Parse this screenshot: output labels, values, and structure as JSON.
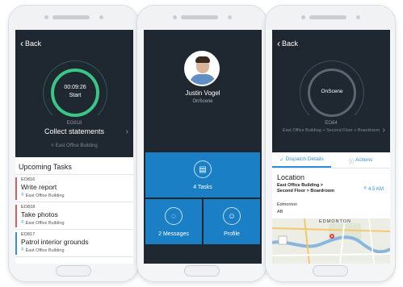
{
  "screen1": {
    "back_label": "Back",
    "timer": {
      "time": "00:09:26",
      "label": "Start"
    },
    "task_code": "EO818",
    "task_title": "Collect statements",
    "location": "East Office Building",
    "upcoming_header": "Upcoming Tasks",
    "tasks": [
      {
        "code": "EO816",
        "name": "Write report",
        "location": "East Office Building",
        "color": "#e05a5a"
      },
      {
        "code": "EO818",
        "name": "Take photos",
        "location": "East Office Building",
        "color": "#e05a5a"
      },
      {
        "code": "EO817",
        "name": "Patrol interior grounds",
        "location": "East Office Building",
        "color": "#3a8fd8"
      }
    ]
  },
  "screen2": {
    "user_name": "Justin Vogel",
    "status": "OnScene",
    "tiles": {
      "tasks": {
        "label": "4 Tasks",
        "icon": "clipboard-icon"
      },
      "messages": {
        "label": "2 Messages",
        "icon": "chat-icon"
      },
      "profile": {
        "label": "Profile",
        "icon": "person-icon"
      }
    }
  },
  "screen3": {
    "back_label": "Back",
    "ring_label": "OnScene",
    "code": "EO84",
    "path": "East Office Building > Second Floor > Boardroom",
    "tabs": {
      "dispatch": "Dispatch Details",
      "actions": "Actions"
    },
    "location_title": "Location",
    "address": "East Office Building > Second Floor > Boardroom",
    "distance": "4.5 KM",
    "city": "Edmonton",
    "province": "AB",
    "map_label": "EDMONTON"
  },
  "colors": {
    "dark_bg": "#1f2730",
    "accent_green": "#39c687",
    "accent_blue": "#1b7fc6",
    "link_blue": "#2f8fdc"
  }
}
